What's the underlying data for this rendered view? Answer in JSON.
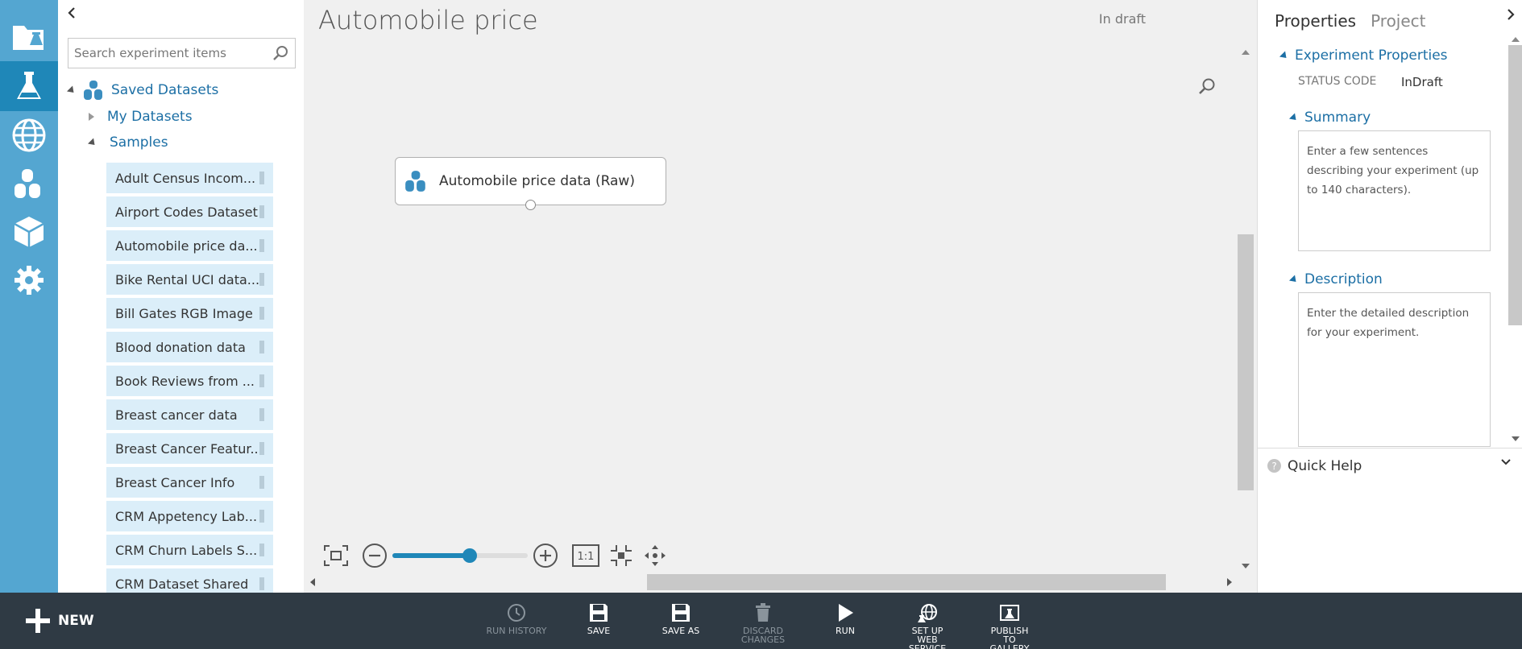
{
  "palette": {
    "collapse_icon": "chevron-left-icon",
    "search": {
      "placeholder": "Search experiment items",
      "value": ""
    },
    "tree": {
      "saved_datasets": "Saved Datasets",
      "my_datasets": "My Datasets",
      "samples": "Samples"
    },
    "samples": [
      "Adult Census Incom...",
      "Airport Codes Dataset",
      "Automobile price da...",
      "Bike Rental UCI data...",
      "Bill Gates RGB Image",
      "Blood donation data",
      "Book Reviews from ...",
      "Breast cancer data",
      "Breast Cancer Featur...",
      "Breast Cancer Info",
      "CRM Appetency Lab...",
      "CRM Churn Labels S...",
      "CRM Dataset Shared"
    ]
  },
  "canvas": {
    "title": "Automobile price",
    "status": "In draft",
    "module_label": "Automobile price data (Raw)",
    "zoom_fraction": 0.57,
    "zoom_fit_label": "1:1"
  },
  "properties": {
    "tab_properties": "Properties",
    "tab_project": "Project",
    "section_experiment": "Experiment Properties",
    "status_code_key": "STATUS CODE",
    "status_code_val": "InDraft",
    "section_summary": "Summary",
    "summary_placeholder": "Enter a few sentences describing your experiment (up to 140 characters).",
    "section_description": "Description",
    "description_placeholder": "Enter the detailed description for your experiment.",
    "quick_help": "Quick Help"
  },
  "bottombar": {
    "new_label": "NEW",
    "buttons": [
      {
        "label": "RUN HISTORY",
        "enabled": false
      },
      {
        "label": "SAVE",
        "enabled": true
      },
      {
        "label": "SAVE AS",
        "enabled": true
      },
      {
        "label": "DISCARD CHANGES",
        "enabled": false
      },
      {
        "label": "RUN",
        "enabled": true
      },
      {
        "label": "SET UP WEB SERVICE",
        "enabled": true
      },
      {
        "label": "PUBLISH TO GALLERY",
        "enabled": true
      }
    ]
  },
  "colors": {
    "nav_bg": "#54a6d1",
    "nav_active": "#1f87b8",
    "accent": "#1c6fa5",
    "sample_bg": "#dbeef9",
    "bottombar_bg": "#2f3a44"
  }
}
